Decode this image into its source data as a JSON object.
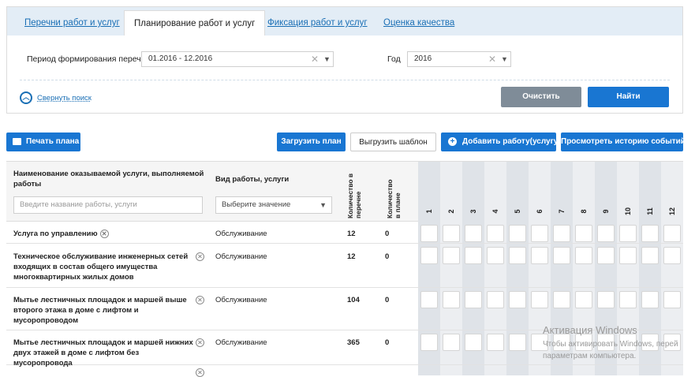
{
  "tabs": [
    {
      "label": "Перечни работ и услуг",
      "active": false
    },
    {
      "label": "Планирование работ и услуг",
      "active": true
    },
    {
      "label": "Фиксация работ и услуг",
      "active": false
    },
    {
      "label": "Оценка качества",
      "active": false
    }
  ],
  "search": {
    "period_label": "Период формирования перечня",
    "period_value": "01.2016 - 12.2016",
    "year_label": "Год",
    "year_value": "2016",
    "collapse_label": "Свернуть поиск",
    "clear_label": "Очистить",
    "find_label": "Найти"
  },
  "toolbar": {
    "print_label": "Печать плана",
    "load_label": "Загрузить план",
    "export_label": "Выгрузить шаблон",
    "add_label": "Добавить работу(услугу)",
    "history_label": "Просмотреть историю событий"
  },
  "table": {
    "col_name": "Наименование оказываемой услуги, выполняемой работы",
    "col_name_placeholder": "Введите название работы, услуги",
    "col_type": "Вид работы, услуги",
    "col_type_placeholder": "Выберите значение",
    "col_qty_list": "Количество в перечне",
    "col_qty_plan": "Количество в плане",
    "months": [
      "1",
      "2",
      "3",
      "4",
      "5",
      "6",
      "7",
      "8",
      "9",
      "10",
      "11",
      "12"
    ],
    "rows": [
      {
        "name": "Услуга по управлению",
        "type": "Обслуживание",
        "qty_list": "12",
        "qty_plan": "0"
      },
      {
        "name": "Техническое обслуживание инженерных сетей входящих в состав общего имущества многоквартирных жилых домов",
        "type": "Обслуживание",
        "qty_list": "12",
        "qty_plan": "0"
      },
      {
        "name": "Мытье лестничных площадок и маршей выше второго этажа в доме с лифтом и мусоропроводом",
        "type": "Обслуживание",
        "qty_list": "104",
        "qty_plan": "0"
      },
      {
        "name": "Мытье лестничных площадок и маршей нижних двух этажей в доме с лифтом без мусоропровода",
        "type": "Обслуживание",
        "qty_list": "365",
        "qty_plan": "0"
      }
    ]
  },
  "watermark": {
    "title": "Активация Windows",
    "line1": "Чтобы активировать Windows, перей",
    "line2": "параметрам компьютера."
  }
}
